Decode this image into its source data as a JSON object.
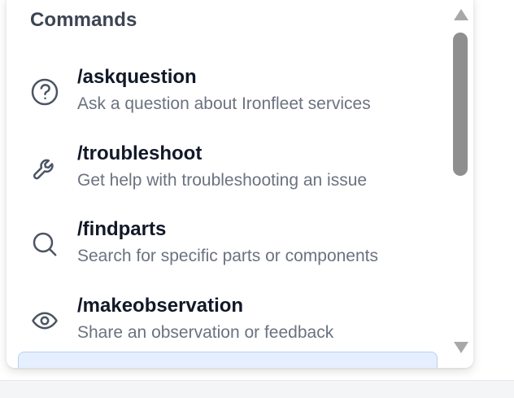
{
  "popup": {
    "title": "Commands",
    "commands": [
      {
        "name": "/askquestion",
        "description": "Ask a question about Ironfleet services",
        "icon": "question-circle-icon"
      },
      {
        "name": "/troubleshoot",
        "description": "Get help with troubleshooting an issue",
        "icon": "wrench-icon"
      },
      {
        "name": "/findparts",
        "description": "Search for specific parts or components",
        "icon": "search-icon"
      },
      {
        "name": "/makeobservation",
        "description": "Share an observation or feedback",
        "icon": "eye-icon"
      }
    ]
  },
  "colors": {
    "icon": "#4b5563",
    "command_name": "#111827",
    "description": "#6b7280",
    "selected_background": "#e5efff",
    "selected_border": "#b8d0f4",
    "scrollbar_thumb": "#8f8f8f",
    "scrollbar_arrow": "#a8a8a8"
  }
}
